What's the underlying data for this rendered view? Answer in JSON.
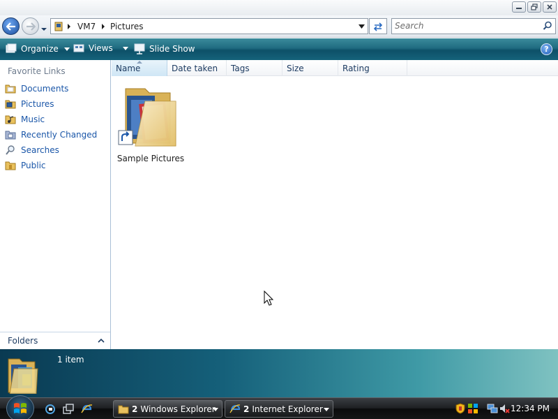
{
  "window": {
    "minimize_label": "Minimize",
    "maximize_label": "Maximize",
    "close_label": "Close"
  },
  "address": {
    "crumbs": [
      "VM7",
      "Pictures"
    ],
    "search_placeholder": "Search"
  },
  "toolbar": {
    "organize_label": "Organize",
    "views_label": "Views",
    "slideshow_label": "Slide Show",
    "help_label": "?"
  },
  "sidebar": {
    "header": "Favorite Links",
    "items": [
      {
        "label": "Documents",
        "icon": "documents-folder-icon"
      },
      {
        "label": "Pictures",
        "icon": "pictures-folder-icon"
      },
      {
        "label": "Music",
        "icon": "music-folder-icon"
      },
      {
        "label": "Recently Changed",
        "icon": "recently-changed-icon"
      },
      {
        "label": "Searches",
        "icon": "searches-icon"
      },
      {
        "label": "Public",
        "icon": "public-folder-icon"
      }
    ],
    "folders_label": "Folders"
  },
  "columns": [
    "Name",
    "Date taken",
    "Tags",
    "Size",
    "Rating"
  ],
  "files": [
    {
      "name": "Sample Pictures",
      "icon": "shortcut-folder-icon"
    }
  ],
  "details": {
    "item_count": "1 item"
  },
  "taskbar": {
    "buttons": [
      {
        "count": "2",
        "label": "Windows Explorer",
        "icon": "folder-icon"
      },
      {
        "count": "2",
        "label": "Internet Explorer",
        "icon": "internet-explorer-icon"
      }
    ],
    "clock": "12:34 PM"
  },
  "colors": {
    "toolbar_teal": "#1f6b80",
    "link_blue": "#1a56a8",
    "taskbar_black": "#1d1f22"
  }
}
